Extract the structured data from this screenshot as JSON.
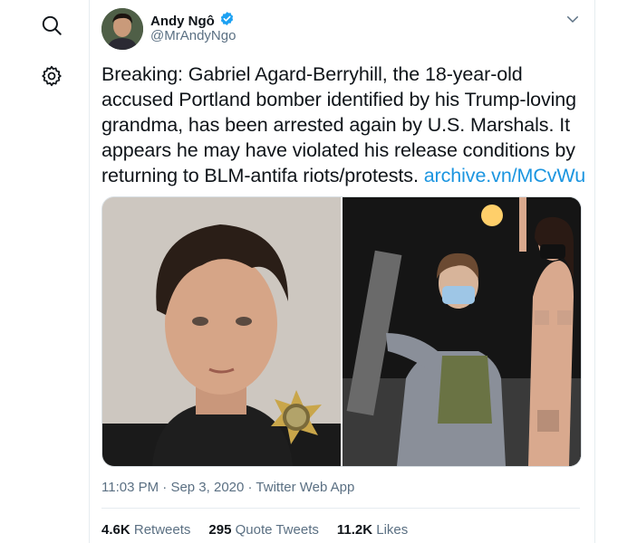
{
  "nav": {
    "icons": [
      "search-icon",
      "gear-icon"
    ]
  },
  "author": {
    "display_name": "Andy Ngô",
    "handle": "@MrAndyNgo",
    "verified": true
  },
  "tweet": {
    "text": "Breaking:  Gabriel Agard-Berryhill, the 18-year-old accused Portland bomber identified by his Trump-loving grandma, has been arrested again by U.S. Marshals. It appears he may have violated his release conditions by returning to BLM-antifa riots/protests. ",
    "link": "archive.vn/MCvWu",
    "media": [
      "mugshot photo",
      "protest photo"
    ]
  },
  "meta": {
    "time": "11:03 PM",
    "sep1": " · ",
    "date": "Sep 3, 2020",
    "sep2": " · ",
    "source": "Twitter Web App"
  },
  "stats": {
    "retweets_count": "4.6K",
    "retweets_label": "Retweets",
    "quotes_count": "295",
    "quotes_label": "Quote Tweets",
    "likes_count": "11.2K",
    "likes_label": "Likes"
  },
  "colors": {
    "link": "#1b95e0",
    "verified": "#1da1f2",
    "secondary_text": "#5b7083",
    "border": "#e6ecf0"
  }
}
